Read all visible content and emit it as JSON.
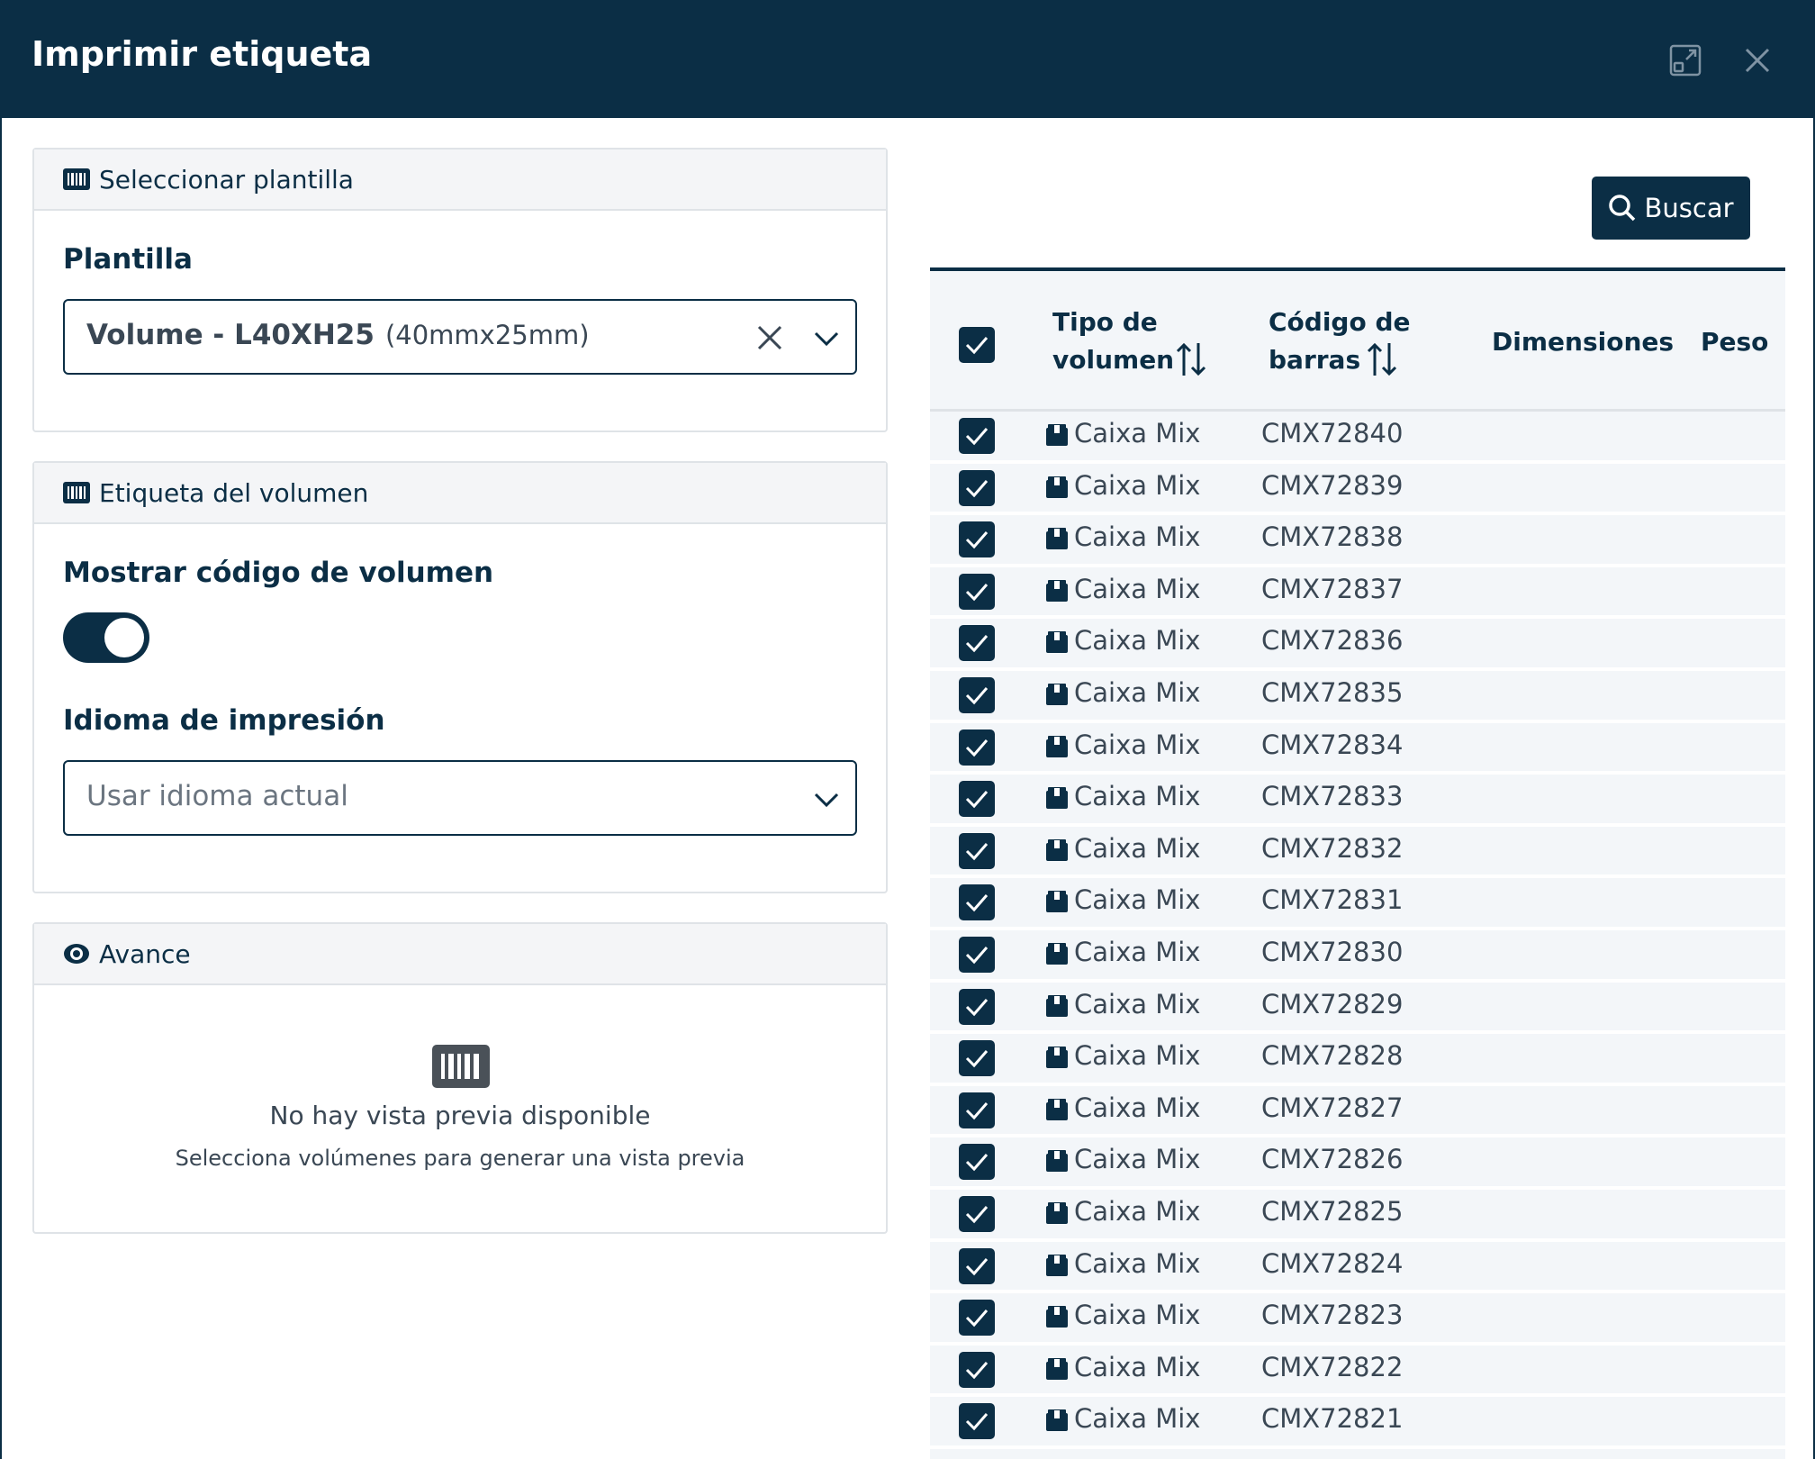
{
  "dialog": {
    "title": "Imprimir etiqueta",
    "expand_icon": "expand-icon",
    "close_icon": "close-icon"
  },
  "template_panel": {
    "header": "Seleccionar plantilla",
    "header_icon": "barcode-icon",
    "field_label": "Plantilla",
    "selected_value": "Volume - L40XH25",
    "selected_detail": "(40mmx25mm)"
  },
  "label_panel": {
    "header": "Etiqueta del volumen",
    "header_icon": "barcode-icon",
    "show_code_label": "Mostrar código de volumen",
    "show_code_enabled": true,
    "language_label": "Idioma de impresión",
    "language_placeholder": "Usar idioma actual"
  },
  "preview_panel": {
    "header": "Avance",
    "header_icon": "eye-icon",
    "empty_icon": "barcode-icon",
    "empty_title": "No hay vista previa disponible",
    "empty_subtitle": "Selecciona volúmenes para generar una vista previa"
  },
  "search": {
    "label": "Buscar",
    "icon": "search-icon"
  },
  "table": {
    "headers": {
      "tipo_line1": "Tipo de",
      "tipo_line2": "volumen",
      "codigo_line1": "Código de",
      "codigo_line2": "barras",
      "dimensiones": "Dimensiones",
      "peso": "Peso"
    },
    "select_all_checked": true,
    "rows": [
      {
        "tipo": "Caixa Mix",
        "codigo": "CMX72840",
        "checked": true
      },
      {
        "tipo": "Caixa Mix",
        "codigo": "CMX72839",
        "checked": true
      },
      {
        "tipo": "Caixa Mix",
        "codigo": "CMX72838",
        "checked": true
      },
      {
        "tipo": "Caixa Mix",
        "codigo": "CMX72837",
        "checked": true
      },
      {
        "tipo": "Caixa Mix",
        "codigo": "CMX72836",
        "checked": true
      },
      {
        "tipo": "Caixa Mix",
        "codigo": "CMX72835",
        "checked": true
      },
      {
        "tipo": "Caixa Mix",
        "codigo": "CMX72834",
        "checked": true
      },
      {
        "tipo": "Caixa Mix",
        "codigo": "CMX72833",
        "checked": true
      },
      {
        "tipo": "Caixa Mix",
        "codigo": "CMX72832",
        "checked": true
      },
      {
        "tipo": "Caixa Mix",
        "codigo": "CMX72831",
        "checked": true
      },
      {
        "tipo": "Caixa Mix",
        "codigo": "CMX72830",
        "checked": true
      },
      {
        "tipo": "Caixa Mix",
        "codigo": "CMX72829",
        "checked": true
      },
      {
        "tipo": "Caixa Mix",
        "codigo": "CMX72828",
        "checked": true
      },
      {
        "tipo": "Caixa Mix",
        "codigo": "CMX72827",
        "checked": true
      },
      {
        "tipo": "Caixa Mix",
        "codigo": "CMX72826",
        "checked": true
      },
      {
        "tipo": "Caixa Mix",
        "codigo": "CMX72825",
        "checked": true
      },
      {
        "tipo": "Caixa Mix",
        "codigo": "CMX72824",
        "checked": true
      },
      {
        "tipo": "Caixa Mix",
        "codigo": "CMX72823",
        "checked": true
      },
      {
        "tipo": "Caixa Mix",
        "codigo": "CMX72822",
        "checked": true
      },
      {
        "tipo": "Caixa Mix",
        "codigo": "CMX72821",
        "checked": true
      }
    ]
  },
  "colors": {
    "primary": "#0b2e45",
    "panel_header_bg": "#f4f5f7",
    "table_bg": "#f3f6f9",
    "text_muted": "#3a4754"
  }
}
